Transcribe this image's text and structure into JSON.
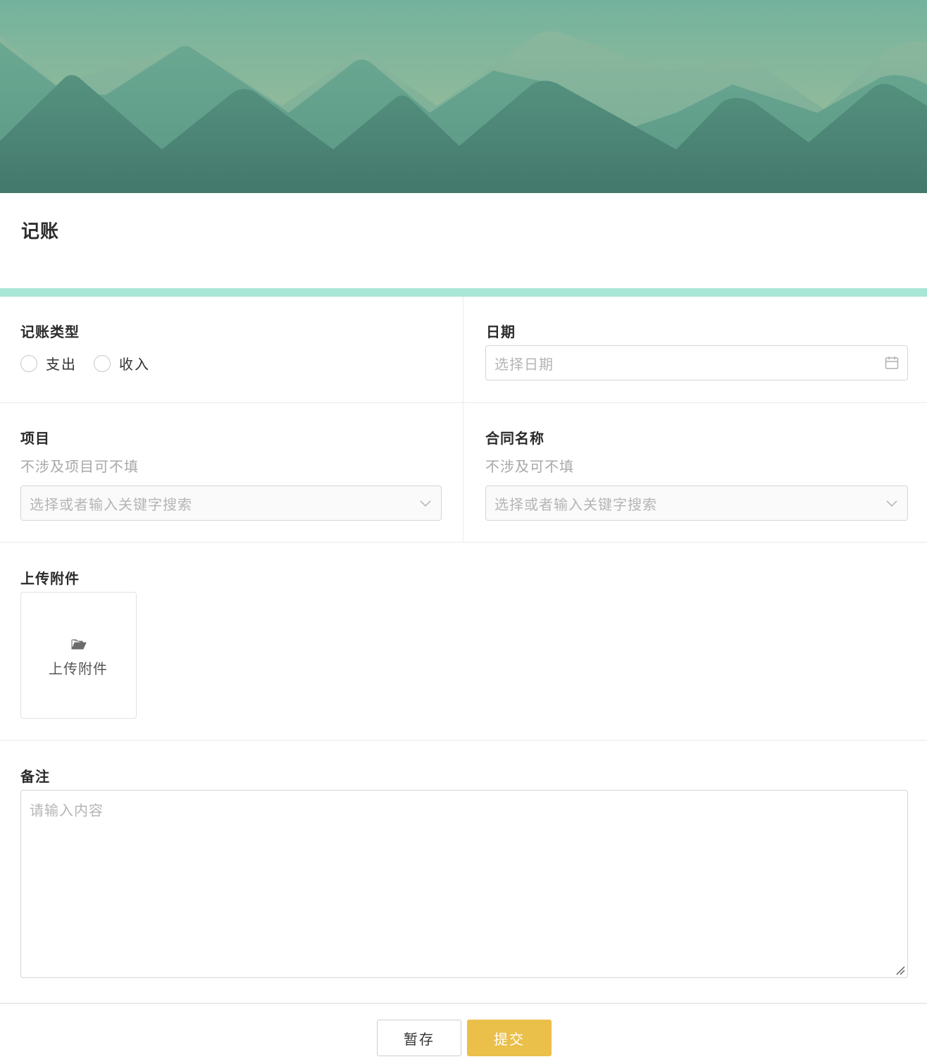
{
  "form": {
    "title": "记账"
  },
  "fields": {
    "type": {
      "label": "记账类型",
      "options": [
        "支出",
        "收入"
      ]
    },
    "date": {
      "label": "日期",
      "placeholder": "选择日期"
    },
    "project": {
      "label": "项目",
      "hint": "不涉及项目可不填",
      "placeholder": "选择或者输入关键字搜索"
    },
    "contract": {
      "label": "合同名称",
      "hint": "不涉及可不填",
      "placeholder": "选择或者输入关键字搜索"
    },
    "attachment": {
      "label": "上传附件",
      "button_label": "上传附件"
    },
    "remark": {
      "label": "备注",
      "placeholder": "请输入内容"
    }
  },
  "footer": {
    "save_label": "暂存",
    "submit_label": "提交"
  },
  "icons": {
    "date": "calendar-icon",
    "select": "chevron-down-icon",
    "upload": "folder-open-icon",
    "resize": "resize-grip-icon"
  },
  "colors": {
    "accent_bar": "#a8e6d6",
    "submit_button": "#eabf4a",
    "banner_sky": "#7fb69f",
    "banner_mountain": "#4a8578"
  }
}
